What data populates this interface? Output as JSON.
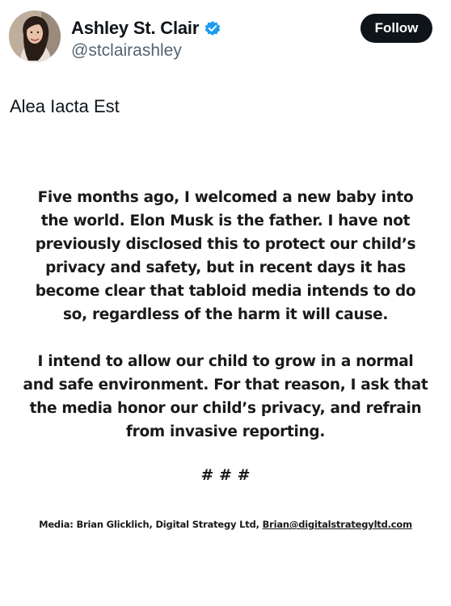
{
  "profile": {
    "display_name": "Ashley St. Clair",
    "handle": "@stclairashley",
    "verified": true,
    "avatar_icon": "profile-photo"
  },
  "actions": {
    "follow_label": "Follow"
  },
  "tweet": {
    "text": "Alea Iacta Est"
  },
  "statement": {
    "paragraph_1": [
      "Five months ago, I welcomed a new baby into",
      "the world. Elon Musk is the father. I have not",
      "previously disclosed this to protect our child’s",
      "privacy and safety, but in recent days it has",
      "become clear that tabloid media intends to do",
      "so, regardless of the harm it will cause."
    ],
    "paragraph_2": [
      "I intend to allow our child to grow in a normal",
      "and safe environment. For that reason, I ask that",
      "the media honor our child’s privacy, and refrain",
      "from invasive reporting."
    ],
    "separator": "# # #",
    "media_prefix": "Media: Brian Glicklich, Digital Strategy Ltd, ",
    "media_email": "Brian@digitalstrategyltd.com"
  },
  "colors": {
    "text": "#0f1419",
    "muted": "#536471",
    "verified_blue": "#1d9bf0",
    "follow_bg": "#0f1419"
  }
}
